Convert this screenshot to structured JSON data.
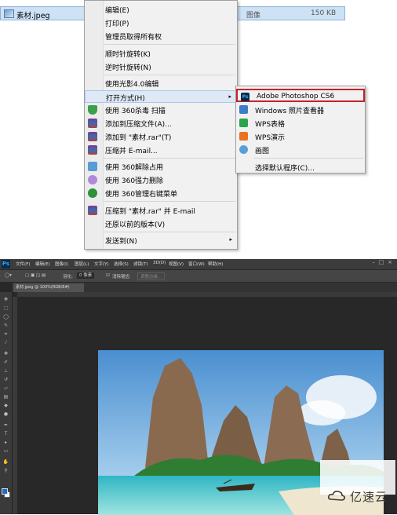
{
  "explorer": {
    "file_name": "素材.jpeg",
    "file_type": "图像",
    "file_size": "150 KB"
  },
  "context_menu": {
    "items": [
      {
        "label": "编辑(E)"
      },
      {
        "label": "打印(P)"
      },
      {
        "label": "管理员取得所有权"
      },
      {
        "label": "顺时针旋转(K)"
      },
      {
        "label": "逆时针旋转(N)"
      },
      {
        "label": "使用光影4.0编辑"
      },
      {
        "label": "打开方式(H)"
      },
      {
        "label": "使用 360杀毒 扫描"
      },
      {
        "label": "添加到压缩文件(A)..."
      },
      {
        "label": "添加到 \"素材.rar\"(T)"
      },
      {
        "label": "压缩并 E-mail..."
      },
      {
        "label": "使用 360解除占用"
      },
      {
        "label": "使用 360强力删除"
      },
      {
        "label": "使用 360管理右键菜单"
      },
      {
        "label": "压缩到 \"素材.rar\" 并 E-mail"
      },
      {
        "label": "还原以前的版本(V)"
      },
      {
        "label": "发送到(N)"
      }
    ],
    "submenu_arrow": "▸"
  },
  "open_with_submenu": {
    "items": [
      {
        "label": "Adobe Photoshop CS6",
        "icon": "photoshop-icon",
        "color": "#0b2a45"
      },
      {
        "label": "Windows 照片查看器",
        "icon": "photo-viewer-icon",
        "color": "#3b7dc6"
      },
      {
        "label": "WPS表格",
        "icon": "wps-spreadsheet-icon",
        "color": "#2aa44f"
      },
      {
        "label": "WPS演示",
        "icon": "wps-presentation-icon",
        "color": "#e8731f"
      },
      {
        "label": "画图",
        "icon": "paint-icon",
        "color": "#5aa0d8"
      },
      {
        "label": "选择默认程序(C)..."
      }
    ],
    "highlight_color": "#c8202a"
  },
  "photoshop": {
    "logo": "Ps",
    "menus": [
      "文件(F)",
      "编辑(E)",
      "图像(I)",
      "图层(L)",
      "文字(Y)",
      "选择(S)",
      "滤镜(T)",
      "3D(D)",
      "视图(V)",
      "窗口(W)",
      "帮助(H)"
    ],
    "window_controls": [
      "–",
      "□",
      "×"
    ],
    "options": {
      "feather_label": "羽化:",
      "feather_value": "0 像素",
      "antialias_label": "消除锯齿",
      "refine_edge": "调整边缘..."
    },
    "document_tab": "素材.jpeg @ 100%(RGB/8#)",
    "tool_icons": [
      "move",
      "marquee",
      "lasso",
      "quick-select",
      "crop",
      "eyedropper",
      "healing",
      "brush",
      "stamp",
      "history-brush",
      "eraser",
      "gradient",
      "blur",
      "dodge",
      "pen",
      "type",
      "path-select",
      "shape",
      "hand",
      "zoom"
    ]
  },
  "watermark": {
    "text": "亿速云"
  }
}
